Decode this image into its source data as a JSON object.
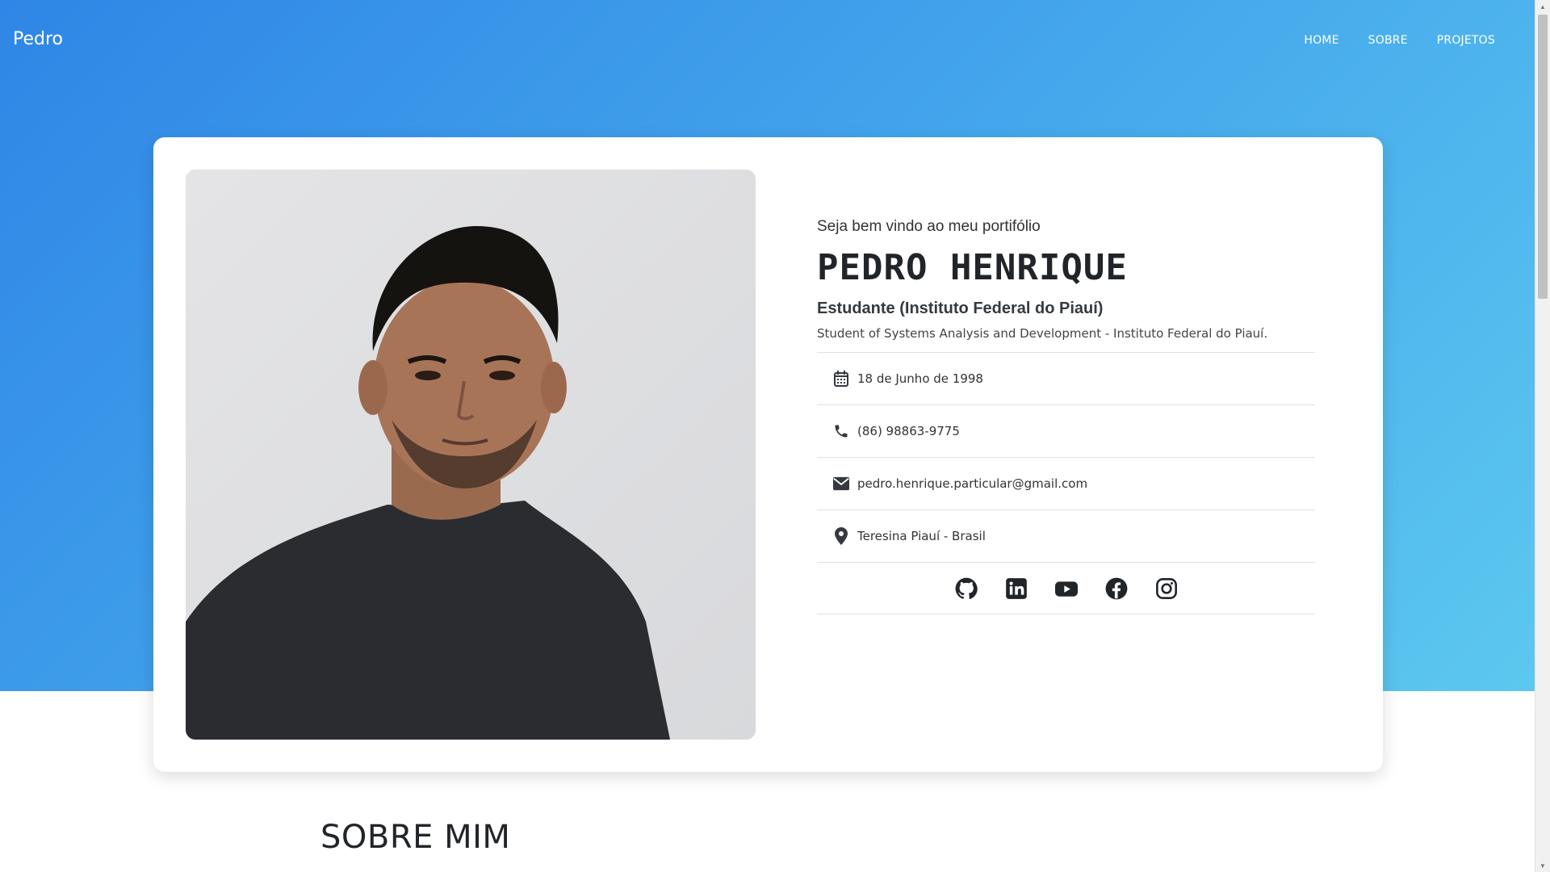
{
  "navbar": {
    "brand": "Pedro",
    "links": [
      "HOME",
      "SOBRE",
      "PROJETOS"
    ]
  },
  "profile": {
    "welcome": "Seja bem vindo ao meu portifólio",
    "name": "PEDRO HENRIQUE",
    "role": "Estudante (Instituto Federal do Piauí)",
    "description": "Student of Systems Analysis and Development - Instituto Federal do Piauí.",
    "details": [
      {
        "icon": "calendar-icon",
        "text": "18 de Junho de 1998"
      },
      {
        "icon": "phone-icon",
        "text": "(86) 98863-9775"
      },
      {
        "icon": "envelope-icon",
        "text": "pedro.henrique.particular@gmail.com"
      },
      {
        "icon": "location-pin-icon",
        "text": "Teresina Piauí - Brasil"
      }
    ],
    "social": [
      "github-icon",
      "linkedin-icon",
      "youtube-icon",
      "facebook-icon",
      "instagram-icon"
    ]
  },
  "about": {
    "title": "SOBRE MIM"
  },
  "colors": {
    "gradient_start": "#2f86e6",
    "gradient_end": "#5cc8ef",
    "card": "#ffffff",
    "text_dark": "#212529"
  }
}
